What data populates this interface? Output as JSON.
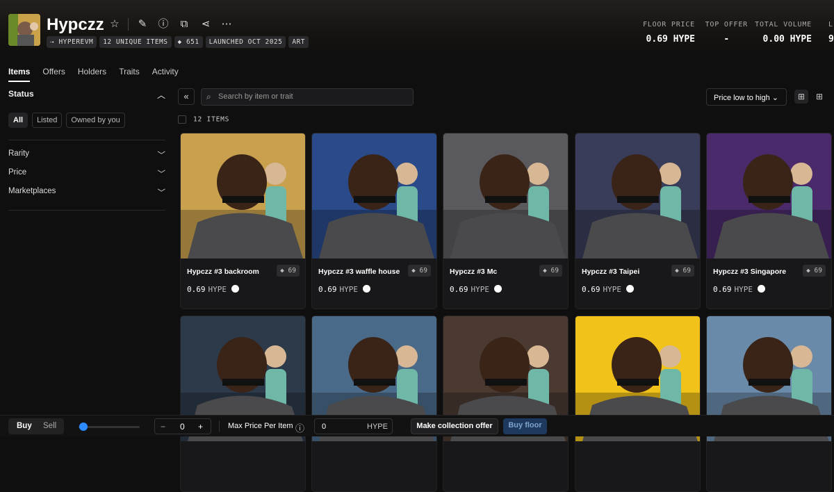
{
  "header": {
    "title": "Hypczz",
    "chips": [
      "⇢ HYPEREVM",
      "12 UNIQUE ITEMS",
      "651",
      "LAUNCHED OCT 2025",
      "ART"
    ],
    "stats": [
      {
        "label": "FLOOR PRICE",
        "value": "0.69 HYPE"
      },
      {
        "label": "TOP OFFER",
        "value": "-"
      },
      {
        "label": "TOTAL VOLUME",
        "value": "0.00 HYPE"
      },
      {
        "label": "L",
        "value": "9"
      }
    ]
  },
  "tabs": [
    "Items",
    "Offers",
    "Holders",
    "Traits",
    "Activity"
  ],
  "sidebar": {
    "status_title": "Status",
    "status_pills": [
      "All",
      "Listed",
      "Owned by you"
    ],
    "filters": [
      "Rarity",
      "Price",
      "Marketplaces"
    ]
  },
  "toolbar": {
    "search_placeholder": "Search by item or trait",
    "sort": "Price low to high",
    "items_count": "12 ITEMS"
  },
  "items": [
    {
      "name": "Hypczz #3 backroom",
      "rank": "69",
      "price": "0.69",
      "unit": "HYPE",
      "bg": "#c9a14e"
    },
    {
      "name": "Hypczz #3 waffle house",
      "rank": "69",
      "price": "0.69",
      "unit": "HYPE",
      "bg": "#2a4a8a"
    },
    {
      "name": "Hypczz #3 Mc",
      "rank": "69",
      "price": "0.69",
      "unit": "HYPE",
      "bg": "#5a5a5e"
    },
    {
      "name": "Hypczz #3 Taipei",
      "rank": "69",
      "price": "0.69",
      "unit": "HYPE",
      "bg": "#3a3d5a"
    },
    {
      "name": "Hypczz #3 Singapore",
      "rank": "69",
      "price": "0.69",
      "unit": "HYPE",
      "bg": "#4a2a6a"
    },
    {
      "name": "",
      "bg": "#2c3a4a"
    },
    {
      "name": "",
      "bg": "#4a6a8a"
    },
    {
      "name": "",
      "bg": "#4a3a32"
    },
    {
      "name": "",
      "bg": "#f0c21a"
    },
    {
      "name": "",
      "bg": "#6a8aaa"
    }
  ],
  "bottom": {
    "buy": "Buy",
    "sell": "Sell",
    "minus": "−",
    "qty": "0",
    "plus": "+",
    "max_label": "Max Price Per Item",
    "max_value": "0",
    "max_unit": "HYPE",
    "offer_btn": "Make collection offer",
    "floor_btn": "Buy floor"
  },
  "colors": {
    "accent": "#2b8cff",
    "buy_floor_bg": "#1d3a5e"
  }
}
